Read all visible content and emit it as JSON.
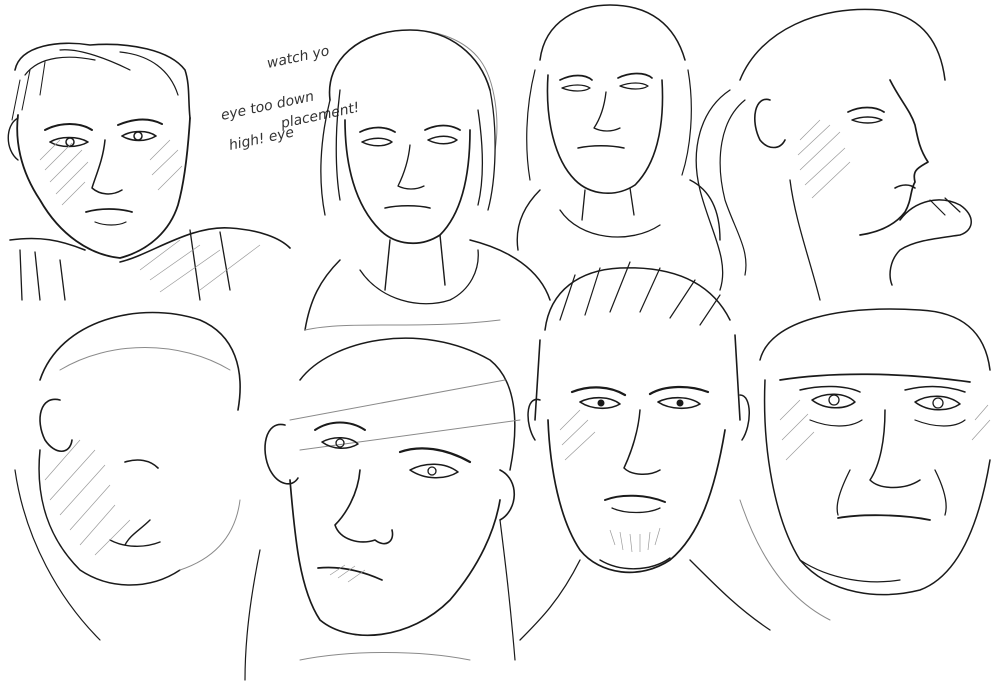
{
  "page": {
    "background": "#ffffff",
    "ink_color": "#1a1a1a",
    "sketch_color": "#8a8a8a"
  },
  "annotation": {
    "line1": "watch yo",
    "line2": "eye too  down",
    "line3": "high!  eye",
    "line4": "placement!"
  },
  "sketches": [
    {
      "name": "face-sketch-1"
    },
    {
      "name": "face-sketch-2"
    },
    {
      "name": "face-sketch-3"
    },
    {
      "name": "face-sketch-4"
    },
    {
      "name": "face-sketch-5"
    },
    {
      "name": "face-sketch-6"
    },
    {
      "name": "face-sketch-7"
    },
    {
      "name": "face-sketch-8"
    }
  ]
}
